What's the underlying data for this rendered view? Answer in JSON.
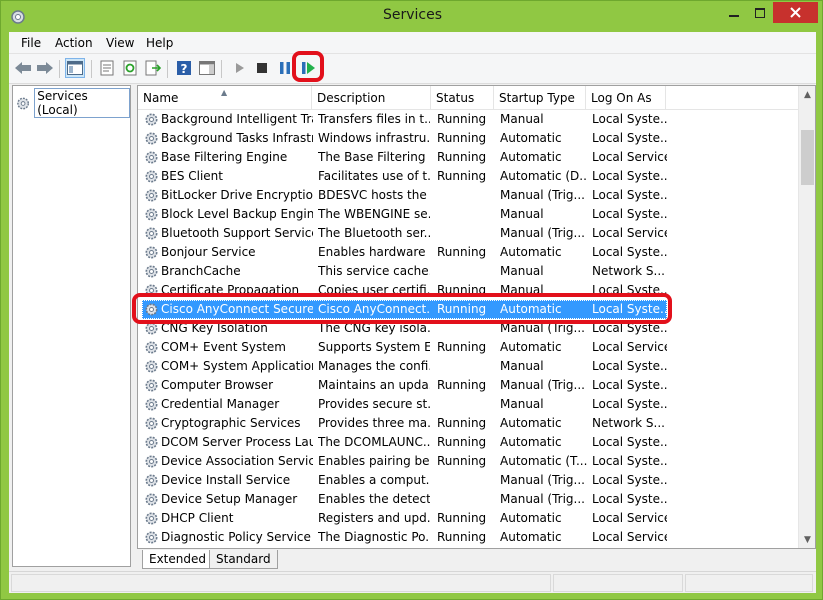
{
  "window": {
    "title": "Services",
    "accent": "#90c843",
    "close_color": "#c7312d"
  },
  "menubar": {
    "items": [
      "File",
      "Action",
      "View",
      "Help"
    ]
  },
  "toolbar": {
    "buttons": [
      "back-icon",
      "forward-icon",
      "show-hide-console-tree-icon",
      "properties-icon",
      "refresh-icon",
      "export-list-icon",
      "help-icon",
      "action-pane-icon",
      "start-service-icon",
      "stop-service-icon",
      "pause-service-icon",
      "resume-service-icon"
    ]
  },
  "tree": {
    "root_label": "Services (Local)"
  },
  "table": {
    "headers": {
      "name": "Name",
      "description": "Description",
      "status": "Status",
      "startup": "Startup Type",
      "logon": "Log On As"
    },
    "rows": [
      {
        "name": "Background Intelligent Tra...",
        "description": "Transfers files in t...",
        "status": "Running",
        "startup": "Manual",
        "logon": "Local Syste..."
      },
      {
        "name": "Background Tasks Infrastr...",
        "description": "Windows infrastru...",
        "status": "Running",
        "startup": "Automatic",
        "logon": "Local Syste..."
      },
      {
        "name": "Base Filtering Engine",
        "description": "The Base Filtering ...",
        "status": "Running",
        "startup": "Automatic",
        "logon": "Local Service"
      },
      {
        "name": "BES Client",
        "description": "Facilitates use of t...",
        "status": "Running",
        "startup": "Automatic (D...",
        "logon": "Local Syste..."
      },
      {
        "name": "BitLocker Drive Encryption...",
        "description": "BDESVC hosts the ...",
        "status": "",
        "startup": "Manual (Trig...",
        "logon": "Local Syste..."
      },
      {
        "name": "Block Level Backup Engine...",
        "description": "The WBENGINE se...",
        "status": "",
        "startup": "Manual",
        "logon": "Local Syste..."
      },
      {
        "name": "Bluetooth Support Service",
        "description": "The Bluetooth ser...",
        "status": "",
        "startup": "Manual (Trig...",
        "logon": "Local Service"
      },
      {
        "name": "Bonjour Service",
        "description": "Enables hardware ...",
        "status": "Running",
        "startup": "Automatic",
        "logon": "Local Syste..."
      },
      {
        "name": "BranchCache",
        "description": "This service cache...",
        "status": "",
        "startup": "Manual",
        "logon": "Network S..."
      },
      {
        "name": "Certificate Propagation",
        "description": "Copies user certifi...",
        "status": "Running",
        "startup": "Manual",
        "logon": "Local Syste..."
      },
      {
        "name": "Cisco AnyConnect Secure ...",
        "description": "Cisco AnyConnect...",
        "status": "Running",
        "startup": "Automatic",
        "logon": "Local Syste...",
        "selected": true
      },
      {
        "name": "CNG Key Isolation",
        "description": "The CNG key isola...",
        "status": "",
        "startup": "Manual (Trig...",
        "logon": "Local Syste..."
      },
      {
        "name": "COM+ Event System",
        "description": "Supports System E...",
        "status": "Running",
        "startup": "Automatic",
        "logon": "Local Service"
      },
      {
        "name": "COM+ System Application",
        "description": "Manages the confi...",
        "status": "",
        "startup": "Manual",
        "logon": "Local Syste..."
      },
      {
        "name": "Computer Browser",
        "description": "Maintains an upda...",
        "status": "Running",
        "startup": "Manual (Trig...",
        "logon": "Local Syste..."
      },
      {
        "name": "Credential Manager",
        "description": "Provides secure st...",
        "status": "",
        "startup": "Manual",
        "logon": "Local Syste..."
      },
      {
        "name": "Cryptographic Services",
        "description": "Provides three ma...",
        "status": "Running",
        "startup": "Automatic",
        "logon": "Network S..."
      },
      {
        "name": "DCOM Server Process Lau...",
        "description": "The DCOMLAUNC...",
        "status": "Running",
        "startup": "Automatic",
        "logon": "Local Syste..."
      },
      {
        "name": "Device Association Service",
        "description": "Enables pairing be...",
        "status": "Running",
        "startup": "Automatic (T...",
        "logon": "Local Syste..."
      },
      {
        "name": "Device Install Service",
        "description": "Enables a comput...",
        "status": "",
        "startup": "Manual (Trig...",
        "logon": "Local Syste..."
      },
      {
        "name": "Device Setup Manager",
        "description": "Enables the detect...",
        "status": "",
        "startup": "Manual (Trig...",
        "logon": "Local Syste..."
      },
      {
        "name": "DHCP Client",
        "description": "Registers and upd...",
        "status": "Running",
        "startup": "Automatic",
        "logon": "Local Service"
      },
      {
        "name": "Diagnostic Policy Service",
        "description": "The Diagnostic Po...",
        "status": "Running",
        "startup": "Automatic",
        "logon": "Local Service"
      }
    ]
  },
  "tabs": {
    "extended": "Extended",
    "standard": "Standard"
  },
  "annotation_color": "#e2101b"
}
